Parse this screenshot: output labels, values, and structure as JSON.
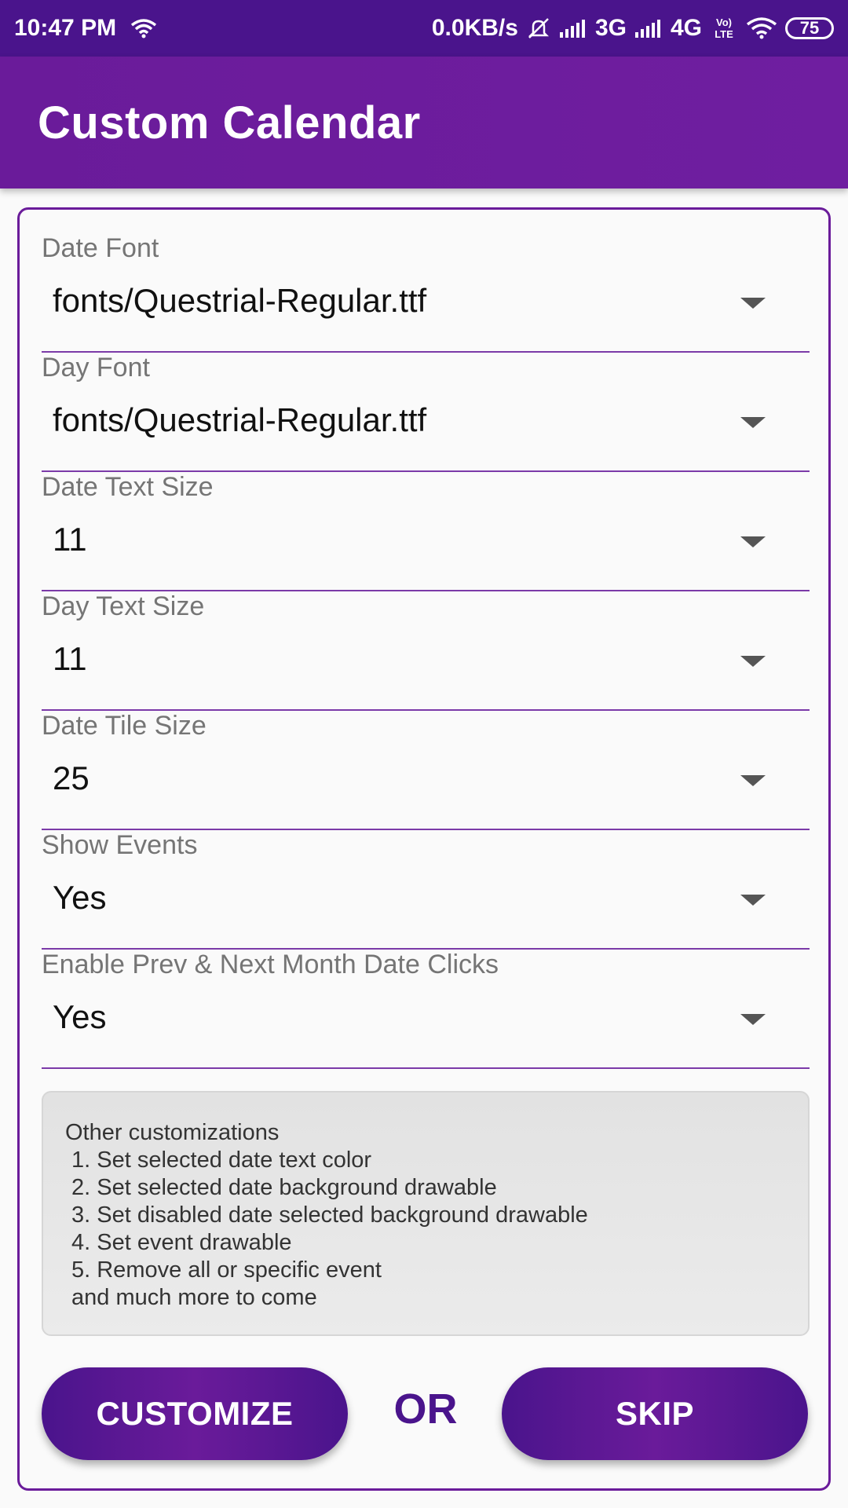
{
  "status_bar": {
    "time": "10:47 PM",
    "network_speed": "0.0KB/s",
    "network_3g": "3G",
    "network_4g": "4G",
    "volte": "VoLTE",
    "battery": "75",
    "icons": [
      "wifi-icon",
      "mute-icon",
      "signal-icon",
      "signal-icon",
      "wifi-icon",
      "battery-icon"
    ]
  },
  "app_bar": {
    "title": "Custom Calendar"
  },
  "fields": [
    {
      "label": "Date Font",
      "value": "fonts/Questrial-Regular.ttf"
    },
    {
      "label": "Day Font",
      "value": "fonts/Questrial-Regular.ttf"
    },
    {
      "label": "Date Text Size",
      "value": "11"
    },
    {
      "label": "Day Text Size",
      "value": "11"
    },
    {
      "label": "Date Tile Size",
      "value": "25"
    },
    {
      "label": "Show Events",
      "value": "Yes"
    },
    {
      "label": "Enable Prev & Next Month Date Clicks",
      "value": "Yes"
    }
  ],
  "info": {
    "heading": "Other customizations",
    "items": [
      "1. Set selected date text color",
      "2. Set selected date background drawable",
      "3. Set disabled date selected background drawable",
      "4. Set event drawable",
      "5. Remove all or specific event"
    ],
    "footer": "and much more to come"
  },
  "actions": {
    "customize_label": "CUSTOMIZE",
    "or_label": "OR",
    "skip_label": "SKIP"
  },
  "colors": {
    "primary_dark": "#4a148c",
    "primary": "#6a1b9a",
    "background": "#fafafa"
  }
}
